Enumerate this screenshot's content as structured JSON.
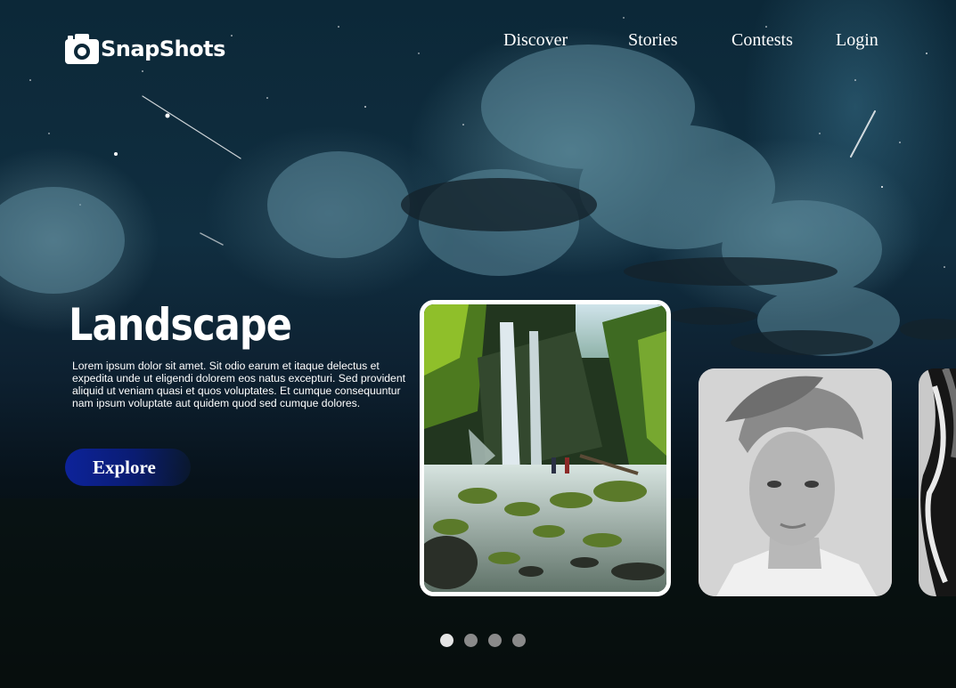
{
  "brand": {
    "name": "SnapShots",
    "logo_icon": "camera-icon"
  },
  "nav": {
    "items": [
      {
        "label": "Discover"
      },
      {
        "label": "Stories"
      },
      {
        "label": "Contests"
      },
      {
        "label": "Login"
      }
    ]
  },
  "hero": {
    "title": "Landscape",
    "description": "Lorem ipsum dolor sit amet. Sit odio earum et itaque delectus et expedita unde ut eligendi dolorem eos natus excepturi. Sed provident aliquid ut veniam quasi et quos voluptates. Et cumque consequuntur nam ipsum voluptate aut quidem quod sed cumque dolores.",
    "cta_label": "Explore"
  },
  "carousel": {
    "cards": [
      {
        "subject": "waterfall-landscape-photo",
        "selected": true
      },
      {
        "subject": "black-and-white-portrait-photo",
        "selected": false
      },
      {
        "subject": "abstract-chrome-photo",
        "selected": false
      }
    ],
    "pagination": {
      "count": 4,
      "active_index": 0
    }
  },
  "colors": {
    "cta_gradient_start": "#0d239a",
    "cta_gradient_end": "#0a1c72",
    "text": "#ffffff",
    "dot_active": "#e5e5e5",
    "dot_inactive": "#8a8a8a"
  }
}
